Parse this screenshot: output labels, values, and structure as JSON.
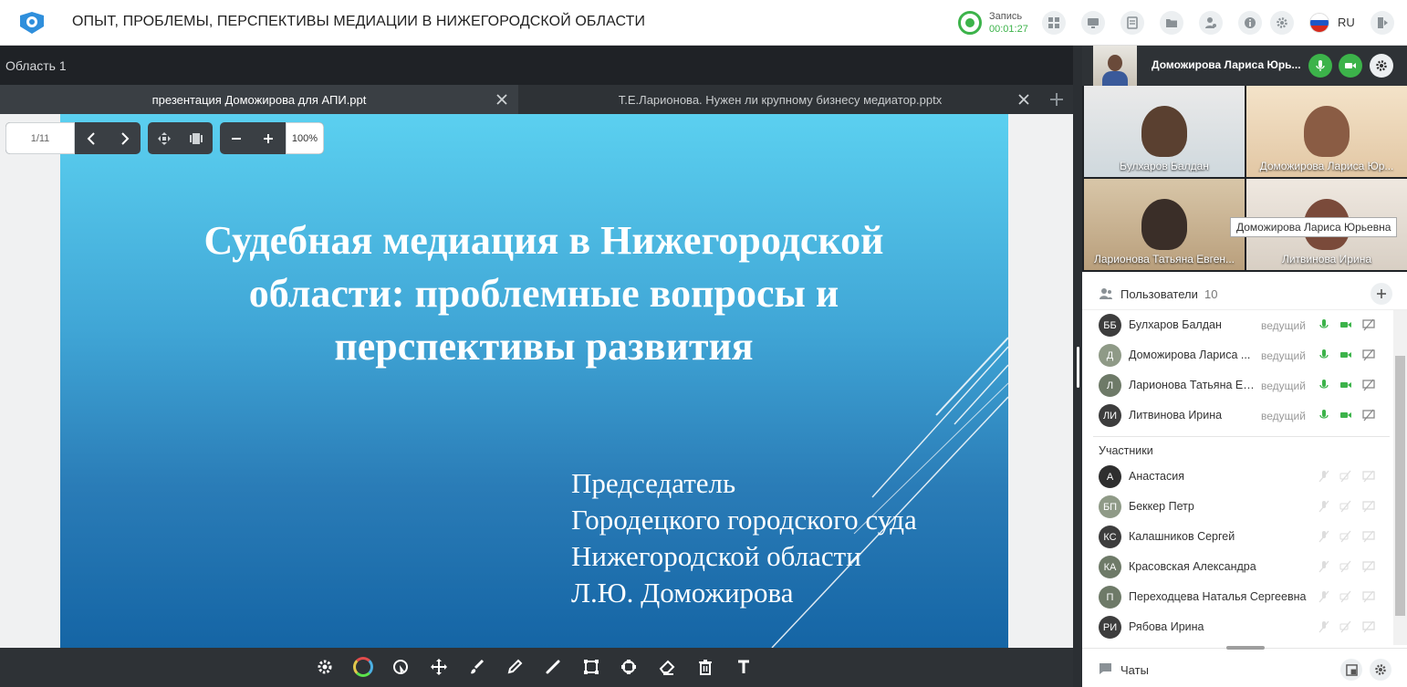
{
  "header": {
    "title": "ОПЫТ, ПРОБЛЕМЫ, ПЕРСПЕКТИВЫ МЕДИАЦИИ В НИЖЕГОРОДСКОЙ ОБЛАСТИ",
    "record_label": "Запись",
    "record_time": "00:01:27",
    "language": "RU"
  },
  "workspace": {
    "area_label": "Область 1",
    "tabs": [
      {
        "label": "презентация Доможирова для АПИ.ppt"
      },
      {
        "label": "Т.Е.Ларионова. Нужен ли крупному бизнесу медиатор.pptx"
      }
    ],
    "page_indicator": "1/11",
    "zoom": "100%"
  },
  "slide": {
    "title_lines": [
      "Судебная медиация в Нижегородской",
      "области: проблемные вопросы и",
      "перспективы развития"
    ],
    "subtitle_lines": [
      "Председатель",
      "Городецкого городского суда",
      "Нижегородской области",
      "Л.Ю. Доможирова"
    ]
  },
  "video": {
    "self_name": "Доможирова Лариса Юрь...",
    "tiles": [
      {
        "name": "Булхаров Балдан"
      },
      {
        "name": "Доможирова Лариса Юр..."
      },
      {
        "name": "Ларионова Татьяна Евген..."
      },
      {
        "name": "Литвинова Ирина"
      }
    ],
    "tooltip": "Доможирова Лариса Юрьевна"
  },
  "users": {
    "title": "Пользователи",
    "count": "10",
    "hosts": [
      {
        "initials": "ББ",
        "name": "Булхаров Балдан",
        "role": "ведущий",
        "color": "#3d3d3d"
      },
      {
        "initials": "Д",
        "name": "Доможирова Лариса ...",
        "role": "ведущий",
        "color": "#8f9a87"
      },
      {
        "initials": "Л",
        "name": "Ларионова Татьяна Ев...",
        "role": "ведущий",
        "color": "#6e7a68"
      },
      {
        "initials": "ЛИ",
        "name": "Литвинова Ирина",
        "role": "ведущий",
        "color": "#3d3d3d"
      }
    ],
    "participants_label": "Участники",
    "participants": [
      {
        "initials": "А",
        "name": "Анастасия",
        "color": "#2f2f2f"
      },
      {
        "initials": "БП",
        "name": "Беккер Петр",
        "color": "#8f9a87"
      },
      {
        "initials": "КС",
        "name": "Калашников Сергей",
        "color": "#3d3d3d"
      },
      {
        "initials": "КА",
        "name": "Красовская Александра",
        "color": "#6e7a68"
      },
      {
        "initials": "П",
        "name": "Переходцева Наталья Сергеевна",
        "color": "#6e7a68"
      },
      {
        "initials": "РИ",
        "name": "Рябова Ирина",
        "color": "#3d3d3d"
      }
    ]
  },
  "chat": {
    "title": "Чаты"
  },
  "colors": {
    "accent_green": "#3cb34a",
    "dark_bg": "#1f2226"
  }
}
